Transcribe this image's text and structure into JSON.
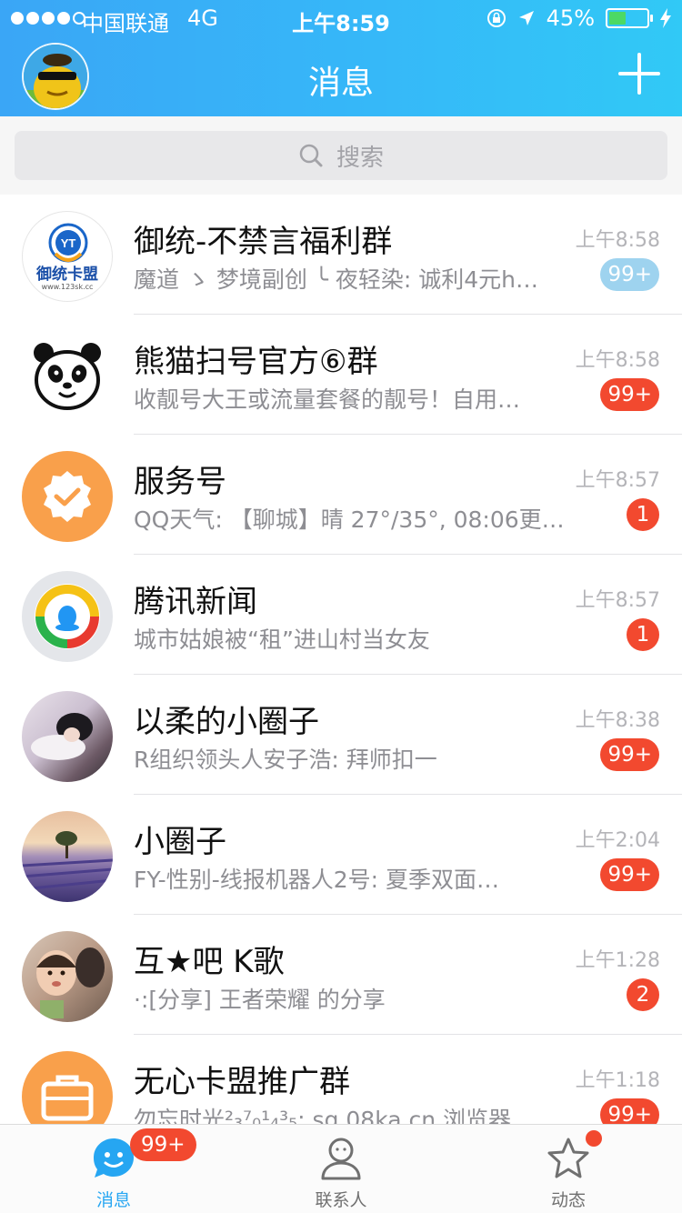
{
  "status_bar": {
    "carrier": "中国联通",
    "network": "4G",
    "time": "上午8:59",
    "battery": "45%"
  },
  "header": {
    "title": "消息"
  },
  "search": {
    "placeholder": "搜索"
  },
  "conversations": [
    {
      "name": "御统-不禁言福利群",
      "preview": "魔道 ゝ 梦境副创 ╰ 夜轻染: 诚利4元h…",
      "time": "上午8:58",
      "badge": "99+",
      "muted": true,
      "avatar_text": "御统卡盟",
      "avatar_sub": "www.123sk.cc"
    },
    {
      "name": "熊猫扫号官方⑥群",
      "preview": "收靓号大王或流量套餐的靓号！自用…",
      "time": "上午8:58",
      "badge": "99+"
    },
    {
      "name": "服务号",
      "preview": "QQ天气: 【聊城】晴 27°/35°, 08:06更…",
      "time": "上午8:57",
      "badge": "1"
    },
    {
      "name": "腾讯新闻",
      "preview": "城市姑娘被“租”进山村当女友",
      "time": "上午8:57",
      "badge": "1"
    },
    {
      "name": "以柔的小圈子",
      "preview": "R组织领头人安子浩: 拜师扣一",
      "time": "上午8:38",
      "badge": "99+"
    },
    {
      "name": "小圈子",
      "preview": "FY-性别-线报机器人2号: 夏季双面…",
      "time": "上午2:04",
      "badge": "99+"
    },
    {
      "name": "互★吧 K歌",
      "preview": "·:[分享] 王者荣耀 的分享",
      "time": "上午1:28",
      "badge": "2"
    },
    {
      "name": "无心卡盟推广群",
      "preview": "勿忘时光²₃⁷₀¹₄³₅: sg.08ka.cn 浏览器…",
      "time": "上午1:18",
      "badge": "99+"
    }
  ],
  "tabs": [
    {
      "label": "消息",
      "badge": "99+"
    },
    {
      "label": "联系人"
    },
    {
      "label": "动态"
    }
  ],
  "colors": {
    "header_start": "#3aa6f6",
    "header_end": "#31c9f6",
    "badge": "#f2492f",
    "badge_muted": "#9ed3ef",
    "tab_active": "#26a6f2"
  }
}
